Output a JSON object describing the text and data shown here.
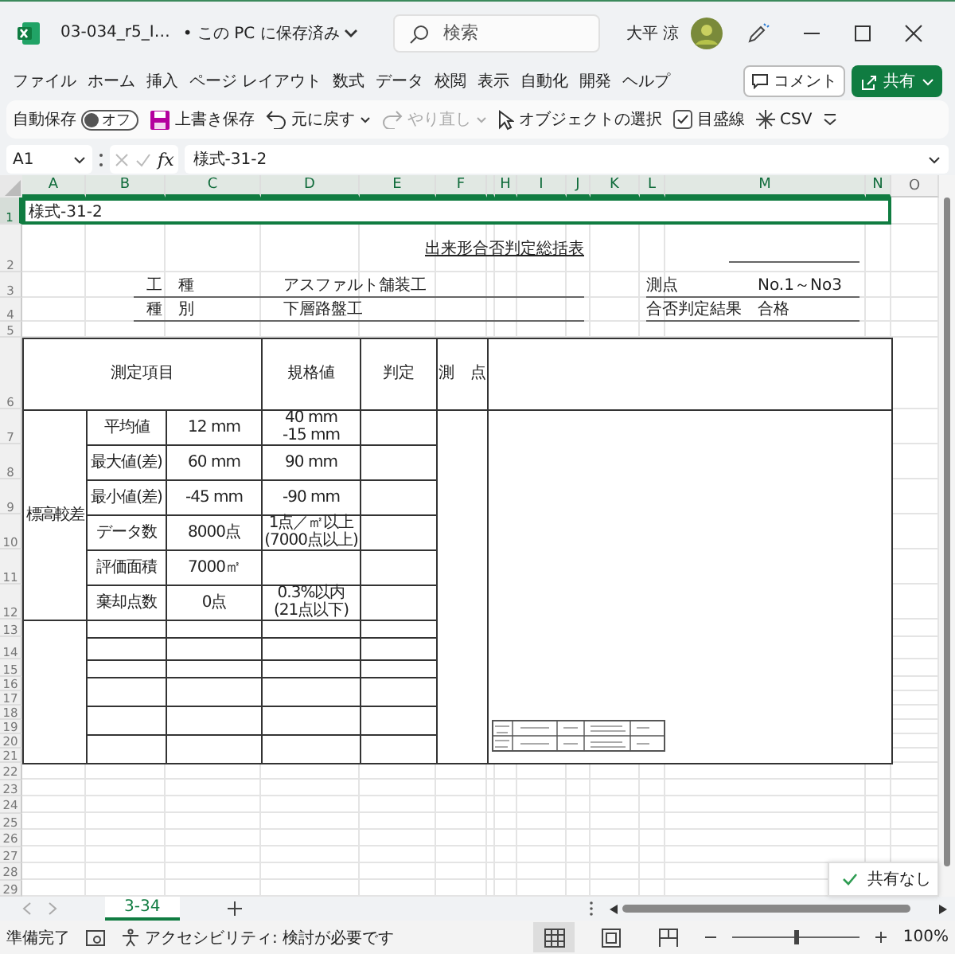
{
  "title_bar": {
    "file_name": "03-034_r5_I…",
    "save_status": "• この PC に保存済み",
    "search_placeholder": "検索",
    "user_name": "大平 涼"
  },
  "menu": [
    "ファイル",
    "ホーム",
    "挿入",
    "ページ レイアウト",
    "数式",
    "データ",
    "校閲",
    "表示",
    "自動化",
    "開発",
    "ヘルプ"
  ],
  "comment_button": "コメント",
  "share_button": "共有",
  "quick_access": {
    "autosave_label": "自動保存",
    "autosave_on": false,
    "autosave_state": "オフ",
    "save": "上書き保存",
    "undo": "元に戻す",
    "redo": "やり直し",
    "redo_disabled": true,
    "select_objects": "オブジェクトの選択",
    "gridlines_label": "目盛線",
    "gridlines_checked": true,
    "csv": "CSV"
  },
  "formula_bar": {
    "name_box": "A1",
    "fx": "fx",
    "formula": "様式-31-2"
  },
  "columns": [
    {
      "label": "A",
      "selected": true
    },
    {
      "label": "B",
      "selected": true
    },
    {
      "label": "C",
      "selected": true
    },
    {
      "label": "D",
      "selected": true
    },
    {
      "label": "E",
      "selected": true
    },
    {
      "label": "F",
      "selected": true
    },
    {
      "selected": true
    },
    {
      "label": "H",
      "selected": true
    },
    {
      "label": "I",
      "selected": true
    },
    {
      "label": "J",
      "selected": true
    },
    {
      "label": "K",
      "selected": true
    },
    {
      "label": "L",
      "selected": true
    },
    {
      "label": "M",
      "selected": true
    },
    {
      "label": "N",
      "selected": true
    },
    {
      "label": "O",
      "selected": false
    }
  ],
  "rows": [
    {
      "label": "1",
      "selected": true
    },
    {
      "label": "2",
      "selected": false
    },
    {
      "label": "3",
      "selected": false
    },
    {
      "label": "4",
      "selected": false
    },
    {
      "label": "5",
      "selected": false
    },
    {
      "label": "6",
      "selected": false
    },
    {
      "label": "7",
      "selected": false
    },
    {
      "label": "8",
      "selected": false
    },
    {
      "label": "9",
      "selected": false
    },
    {
      "label": "10",
      "selected": false
    },
    {
      "label": "11",
      "selected": false
    },
    {
      "label": "12",
      "selected": false
    },
    {
      "label": "13",
      "selected": false
    },
    {
      "label": "14",
      "selected": false
    },
    {
      "label": "15",
      "selected": false
    },
    {
      "label": "16",
      "selected": false
    },
    {
      "label": "17",
      "selected": false
    },
    {
      "label": "18",
      "selected": false
    },
    {
      "label": "19",
      "selected": false
    },
    {
      "label": "20",
      "selected": false
    },
    {
      "label": "21",
      "selected": false
    },
    {
      "label": "22",
      "selected": false
    },
    {
      "label": "23",
      "selected": false
    },
    {
      "label": "24",
      "selected": false
    },
    {
      "label": "25",
      "selected": false
    },
    {
      "label": "26",
      "selected": false
    },
    {
      "label": "27",
      "selected": false
    },
    {
      "label": "28",
      "selected": false
    },
    {
      "label": "29",
      "selected": false
    }
  ],
  "form": {
    "code": "様式-31-2",
    "title": "出来形合否判定総括表",
    "left_fields": [
      {
        "label": "工　種",
        "value": "アスファルト舗装工"
      },
      {
        "label": "種　別",
        "value": "下層路盤工"
      }
    ],
    "right_fields": [
      {
        "label": "測点",
        "value": "No.1～No3"
      },
      {
        "label": "合否判定結果",
        "value": "合格"
      }
    ],
    "headers": [
      "測定項目",
      "規格値",
      "判定",
      "測　点"
    ],
    "group_label": "標高較差",
    "rows": [
      {
        "item": "平均値",
        "value": "12 mm",
        "spec": [
          "40 mm",
          "-15 mm"
        ]
      },
      {
        "item": "最大値(差)",
        "value": "60 mm",
        "spec": [
          "90 mm"
        ]
      },
      {
        "item": "最小値(差)",
        "value": "-45 mm",
        "spec": [
          "-90 mm"
        ]
      },
      {
        "item": "データ数",
        "value": "8000点",
        "spec": [
          "1点／㎡以上",
          "(7000点以上)"
        ]
      },
      {
        "item": "評価面積",
        "value": "7000㎡"
      },
      {
        "item": "棄却点数",
        "value": "0点",
        "spec": [
          "0.3%以内",
          "(21点以下)"
        ]
      }
    ]
  },
  "sheet_tabs": [
    {
      "label": "3-34",
      "selected": true
    }
  ],
  "toast": "共有なし",
  "status_bar": {
    "ready": "準備完了",
    "accessibility": "アクセシビリティ: 検討が必要です",
    "views": [
      {
        "kind": "normal",
        "selected": true
      },
      {
        "kind": "page_layout",
        "selected": false
      },
      {
        "kind": "page_break",
        "selected": false
      }
    ],
    "zoom": {
      "level": 0.5,
      "reading": "100%"
    }
  }
}
